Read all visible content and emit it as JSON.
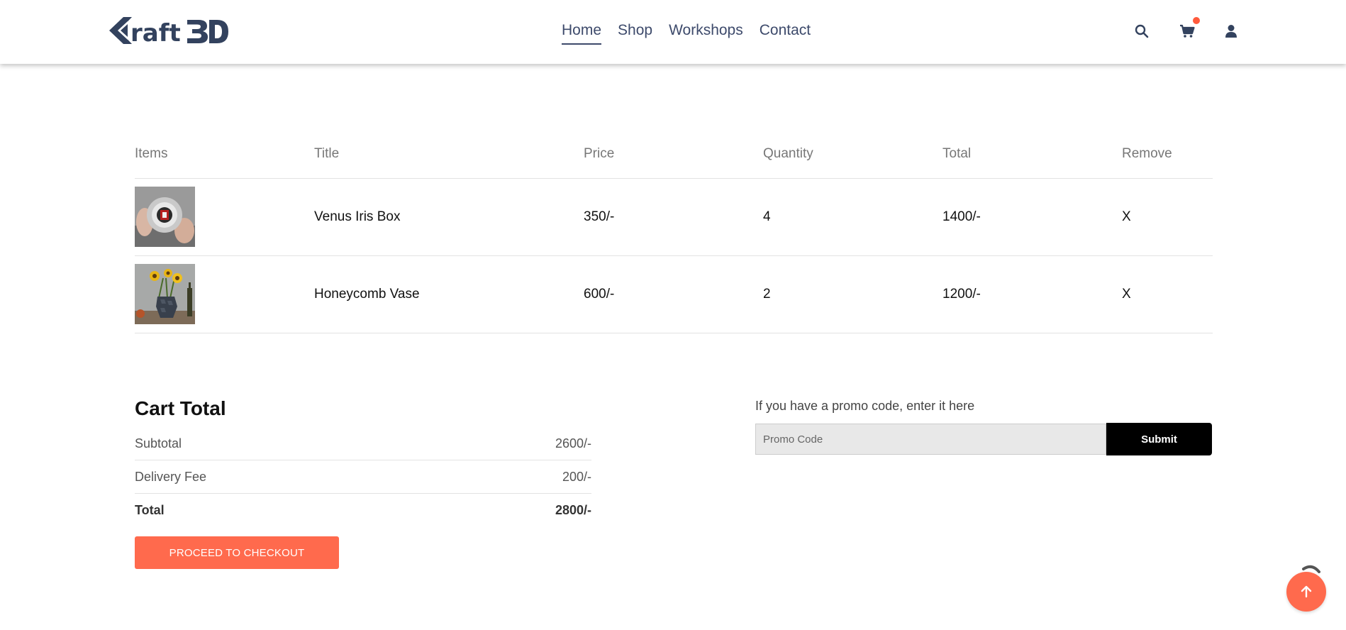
{
  "brand": {
    "logo_text": "Kraft3D"
  },
  "nav": {
    "items": [
      {
        "label": "Home",
        "active": true
      },
      {
        "label": "Shop",
        "active": false
      },
      {
        "label": "Workshops",
        "active": false
      },
      {
        "label": "Contact",
        "active": false
      }
    ]
  },
  "header_icons": [
    "search-icon",
    "cart-icon",
    "user-icon"
  ],
  "cart_table": {
    "headers": [
      "Items",
      "Title",
      "Price",
      "Quantity",
      "Total",
      "Remove"
    ],
    "rows": [
      {
        "image": "venus-iris-box-photo",
        "title": "Venus Iris Box",
        "price": "350/-",
        "quantity": "4",
        "total": "1400/-",
        "remove": "X"
      },
      {
        "image": "honeycomb-vase-photo",
        "title": "Honeycomb Vase",
        "price": "600/-",
        "quantity": "2",
        "total": "1200/-",
        "remove": "X"
      }
    ]
  },
  "cart_total": {
    "title": "Cart Total",
    "subtotal_label": "Subtotal",
    "subtotal_value": "2600/-",
    "delivery_label": "Delivery Fee",
    "delivery_value": "200/-",
    "total_label": "Total",
    "total_value": "2800/-",
    "checkout_label": "PROCEED TO CHECKOUT"
  },
  "promo": {
    "label": "If you have a promo code, enter it here",
    "placeholder": "Promo Code",
    "value": "",
    "submit_label": "Submit"
  },
  "colors": {
    "accent": "#ff6a4d",
    "nav_text": "#3d4a6b",
    "cart_badge": "#ff5a3c"
  }
}
